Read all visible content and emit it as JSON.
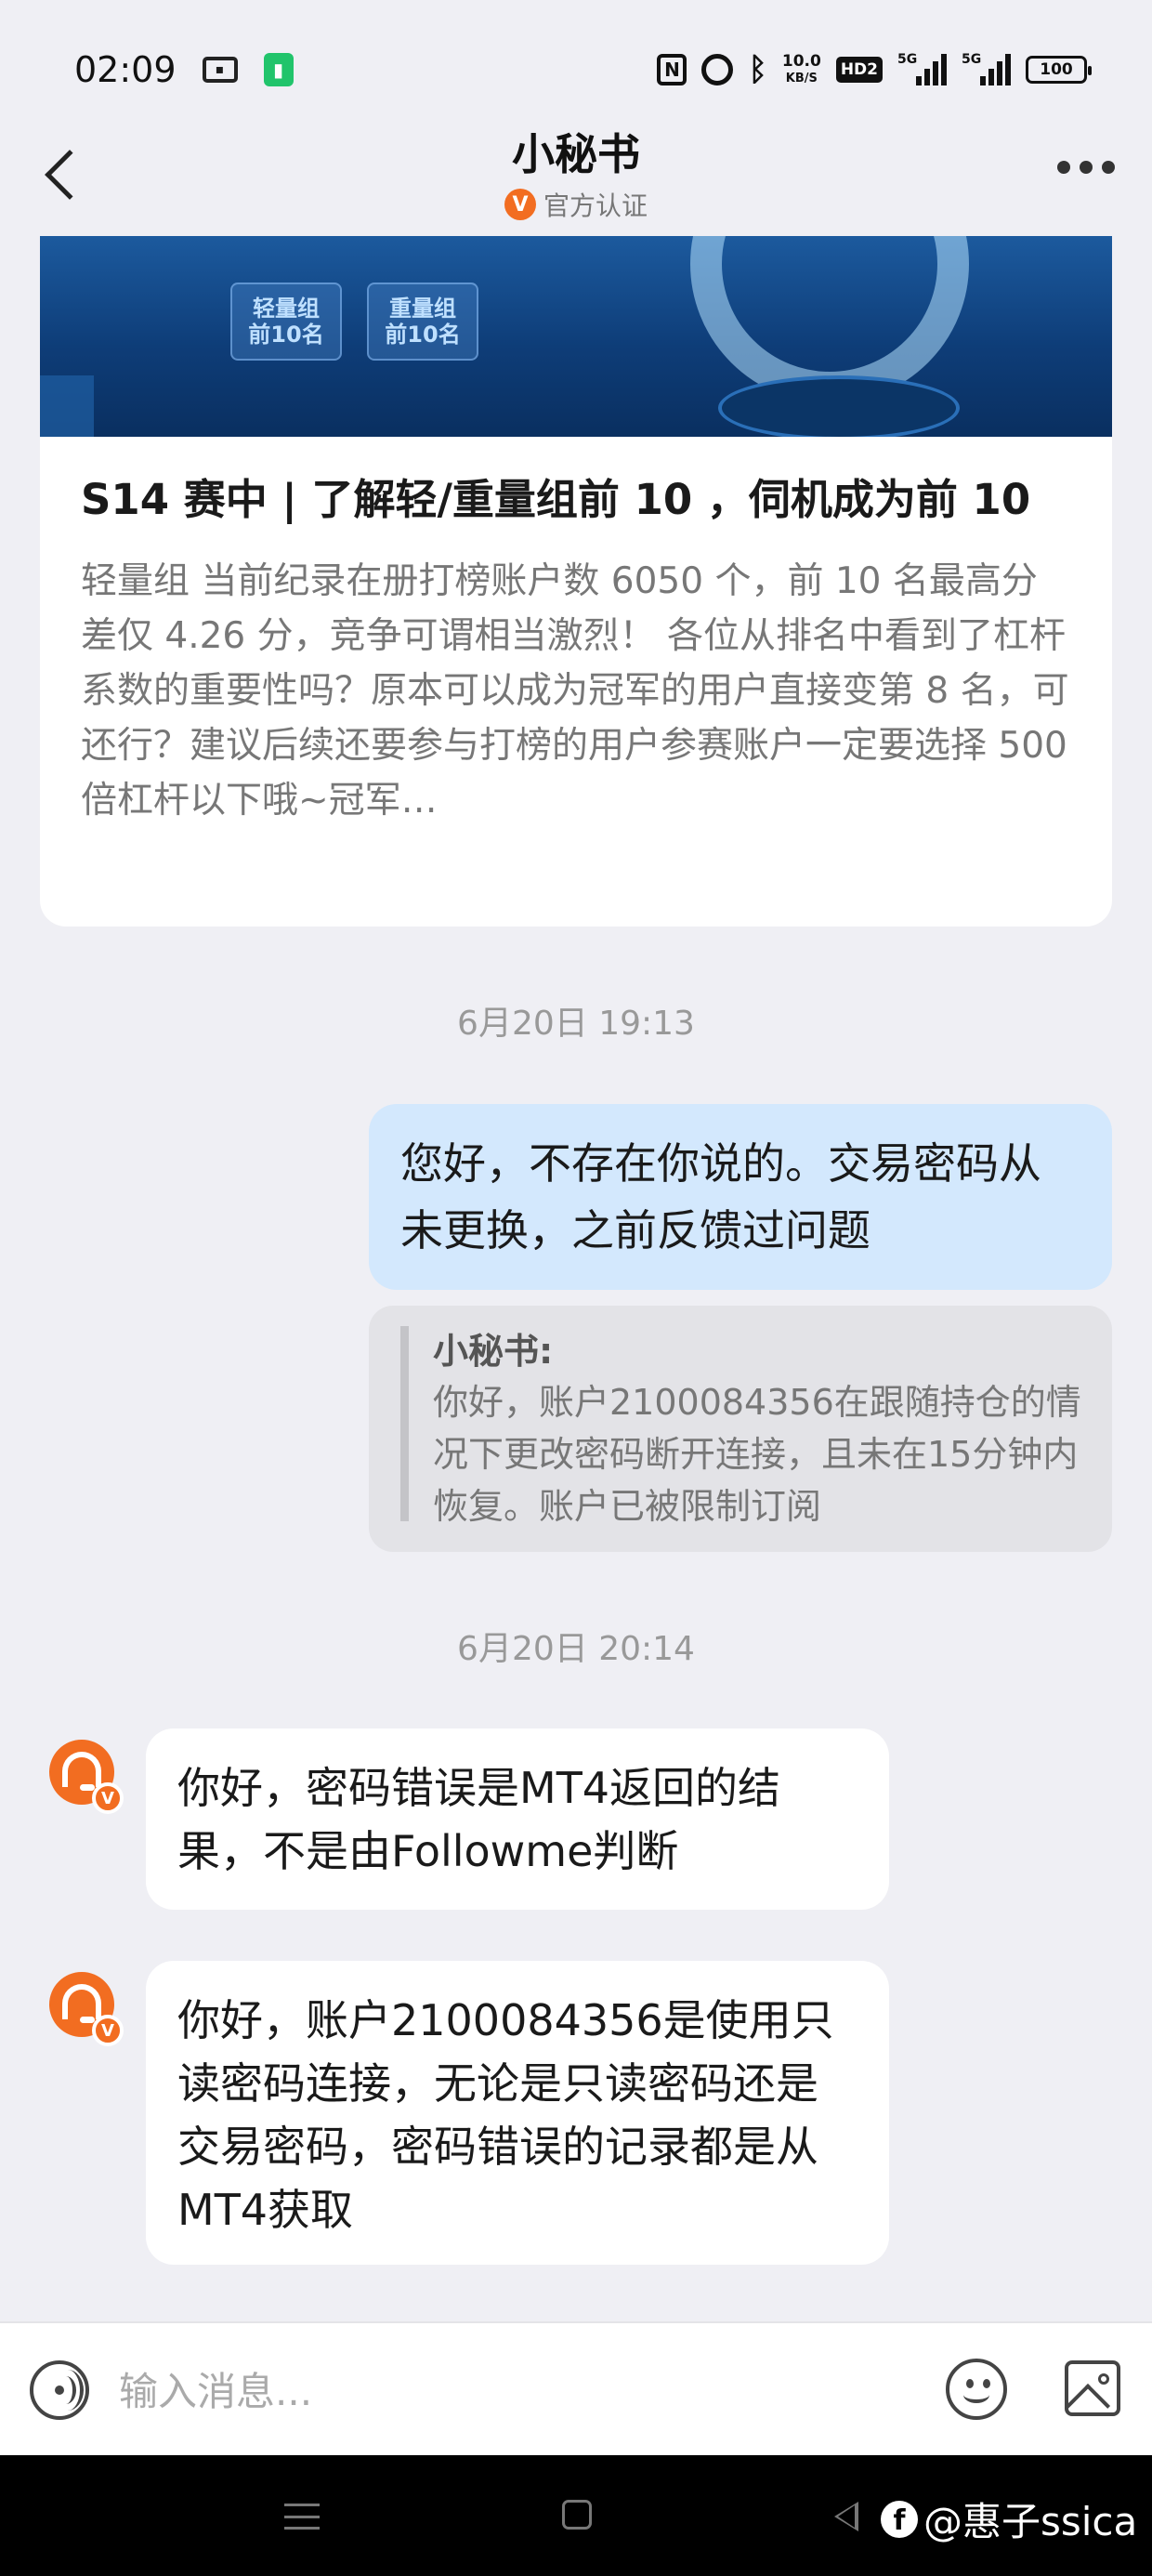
{
  "status_bar": {
    "time": "02:09",
    "network_speed_value": "10.0",
    "network_speed_unit": "KB/S",
    "hd_label": "HD2",
    "signal_1_label": "5G",
    "signal_2_label": "5G",
    "battery": "100",
    "icons": [
      "card-icon",
      "green-app-icon",
      "nfc-icon",
      "alarm-icon",
      "bluetooth-icon",
      "signal-icon",
      "battery-icon"
    ]
  },
  "header": {
    "title": "小秘书",
    "subtitle": "官方认证",
    "verified_badge": "V",
    "icons": [
      "back-arrow-icon",
      "verified-badge-icon",
      "more-options-icon"
    ]
  },
  "article": {
    "banner_tags": [
      "轻量组\n前10名",
      "重量组\n前10名"
    ],
    "title": "S14 赛中 | 了解轻/重量组前 10 ，伺机成为前 10",
    "excerpt": "轻量组 当前纪录在册打榜账户数 6050 个，前 10 名最高分差仅 4.26 分，竞争可谓相当激烈！ 各位从排名中看到了杠杆系数的重要性吗？原本可以成为冠军的用户直接变第 8 名，可还行？建议后续还要参与打榜的用户参赛账户一定要选择 500 倍杠杆以下哦~冠军…"
  },
  "messages": {
    "timestamp_1": "6月20日 19:13",
    "sent_1": "您好，不存在你说的。交易密码从未更换，之前反馈过问题",
    "quote_author": "小秘书:",
    "quote_text": "你好，账户2100084356在跟随持仓的情况下更改密码断开连接，且未在15分钟内恢复。账户已被限制订阅",
    "timestamp_2": "6月20日 20:14",
    "received_1": "你好，密码错误是MT4返回的结果，不是由Followme判断",
    "received_2": "你好，账户2100084356是使用只读密码连接，无论是只读密码还是交易密码，密码错误的记录都是从MT4获取",
    "avatar_badge": "V"
  },
  "input_bar": {
    "placeholder": "输入消息...",
    "icons": [
      "voice-icon",
      "emoji-icon",
      "image-icon"
    ]
  },
  "nav_bar": {
    "watermark_logo": "f",
    "watermark_text": "@惠子ssica",
    "icons": [
      "menu-icon",
      "home-icon",
      "back-triangle-icon"
    ]
  },
  "colors": {
    "accent_orange": "#f26d21",
    "sent_bubble": "#d3e8fd",
    "background": "#efeff4"
  }
}
